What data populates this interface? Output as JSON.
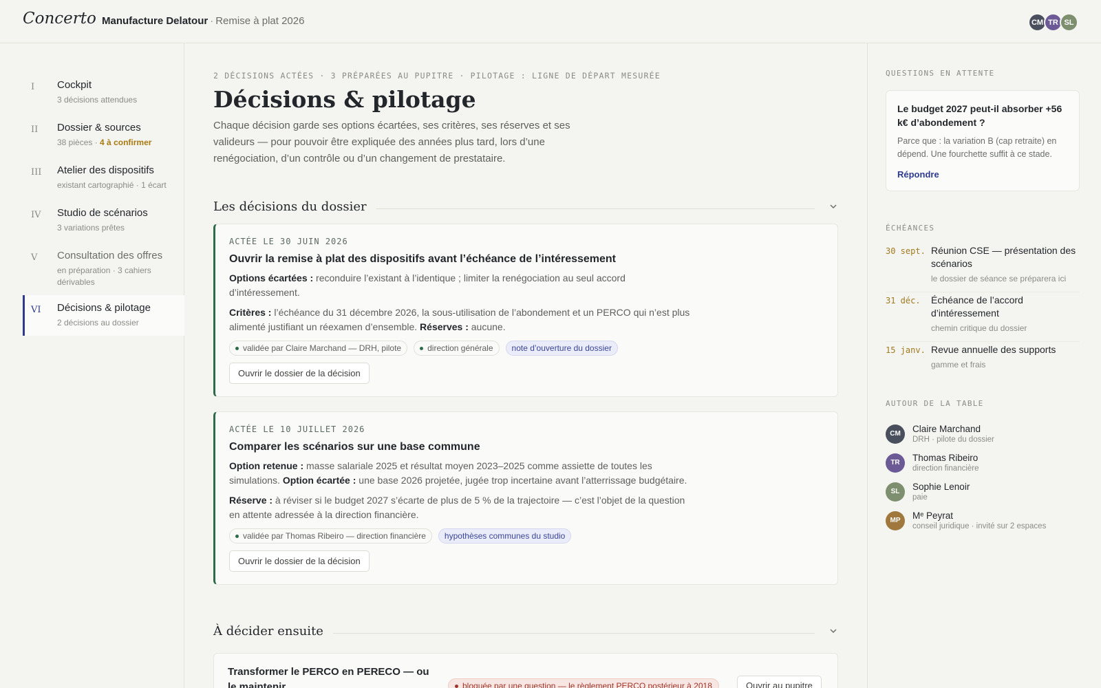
{
  "app": {
    "logo": "Concerto",
    "org": "Manufacture Delatour",
    "separator": "·",
    "project": "Remise à plat 2026",
    "avatars": [
      {
        "initials": "CM",
        "color": "#4a4f5e"
      },
      {
        "initials": "TR",
        "color": "#6b5a96"
      },
      {
        "initials": "SL",
        "color": "#7d8f6e"
      }
    ]
  },
  "sidebar": {
    "items": [
      {
        "num": "I",
        "label": "Cockpit",
        "meta": "3 décisions attendues"
      },
      {
        "num": "II",
        "label": "Dossier & sources",
        "meta": "38 pièces ·",
        "meta_warn": "4 à confirmer"
      },
      {
        "num": "III",
        "label": "Atelier des dispositifs",
        "meta": "existant cartographié · 1 écart"
      },
      {
        "num": "IV",
        "label": "Studio de scénarios",
        "meta": "3 variations prêtes"
      },
      {
        "num": "V",
        "label": "Consultation des offres",
        "meta": "en préparation · 3 cahiers dérivables"
      },
      {
        "num": "VI",
        "label": "Décisions & pilotage",
        "meta": "2 décisions au dossier"
      }
    ]
  },
  "main": {
    "kicker": "2 DÉCISIONS ACTÉES · 3 PRÉPARÉES AU PUPITRE · PILOTAGE : LIGNE DE DÉPART MESURÉE",
    "title": "Décisions & pilotage",
    "intro": "Chaque décision garde ses options écartées, ses critères, ses réserves et ses valideurs — pour pouvoir être expliquée des années plus tard, lors d’une renégociation, d’un contrôle ou d’un changement de prestataire.",
    "section1": "Les décisions du dossier",
    "section2": "À décider ensuite",
    "decisions": [
      {
        "date": "ACTÉE LE 30 JUIN 2026",
        "title": "Ouvrir la remise à plat des dispositifs avant l’échéance de l’intéressement",
        "p1_label": "Options écartées :",
        "p1_text": " reconduire l’existant à l’identique ; limiter la renégociation au seul accord d’intéressement.",
        "p2_label": "Critères :",
        "p2_text": " l’échéance du 31 décembre 2026, la sous-utilisation de l’abondement et un PERCO qui n’est plus alimenté justifiant un réexamen d’ensemble. ",
        "p2_label2": "Réserves :",
        "p2_text2": " aucune.",
        "chip1": "validée par Claire Marchand — DRH, pilote",
        "chip2": "direction générale",
        "chip3": "note d’ouverture du dossier",
        "button": "Ouvrir le dossier de la décision"
      },
      {
        "date": "ACTÉE LE 10 JUILLET 2026",
        "title": "Comparer les scénarios sur une base commune",
        "p1_label": "Option retenue :",
        "p1_text": " masse salariale 2025 et résultat moyen 2023–2025 comme assiette de toutes les simulations. ",
        "p1_label2": "Option écartée :",
        "p1_text2": " une base 2026 projetée, jugée trop incertaine avant l’atterrissage budgétaire.",
        "p2_label": "Réserve :",
        "p2_text": " à réviser si le budget 2027 s’écarte de plus de 5 % de la trajectoire — c’est l’objet de la question en attente adressée à la direction financière.",
        "chip1": "validée par Thomas Ribeiro — direction financière",
        "chip3": "hypothèses communes du studio",
        "button": "Ouvrir le dossier de la décision"
      }
    ],
    "next": {
      "title": "Transformer le PERCO en PERECO — ou le maintenir",
      "blocked": "bloquée par une question — le règlement PERCO postérieur à 2018",
      "button": "Ouvrir au pupitre"
    }
  },
  "rail": {
    "questions_head": "QUESTIONS EN ATTENTE",
    "question": "Le budget 2027 peut-il absorber +56 k€ d’abondement ?",
    "question_detail": "Parce que : la variation B (cap retraite) en dépend. Une fourchette suffit à ce stade.",
    "answer": "Répondre",
    "deadlines_head": "ÉCHÉANCES",
    "deadlines": [
      {
        "date": "30 sept.",
        "title": "Réunion CSE — présentation des scénarios",
        "sub": "le dossier de séance se préparera ici"
      },
      {
        "date": "31 déc.",
        "title": "Échéance de l’accord d’intéressement",
        "sub": "chemin critique du dossier"
      },
      {
        "date": "15 janv.",
        "title": "Revue annuelle des supports",
        "sub": "gamme et frais"
      }
    ],
    "people_head": "AUTOUR DE LA TABLE",
    "people": [
      {
        "initials": "CM",
        "name": "Claire Marchand",
        "role": "DRH · pilote du dossier",
        "color": "#4a4f5e"
      },
      {
        "initials": "TR",
        "name": "Thomas Ribeiro",
        "role": "direction financière",
        "color": "#6b5a96"
      },
      {
        "initials": "SL",
        "name": "Sophie Lenoir",
        "role": "paie",
        "color": "#7d8f6e"
      },
      {
        "initials": "MP",
        "name": "Mᵉ Peyrat",
        "role": "conseil juridique · invité sur 2 espaces",
        "color": "#a0783e"
      }
    ]
  }
}
